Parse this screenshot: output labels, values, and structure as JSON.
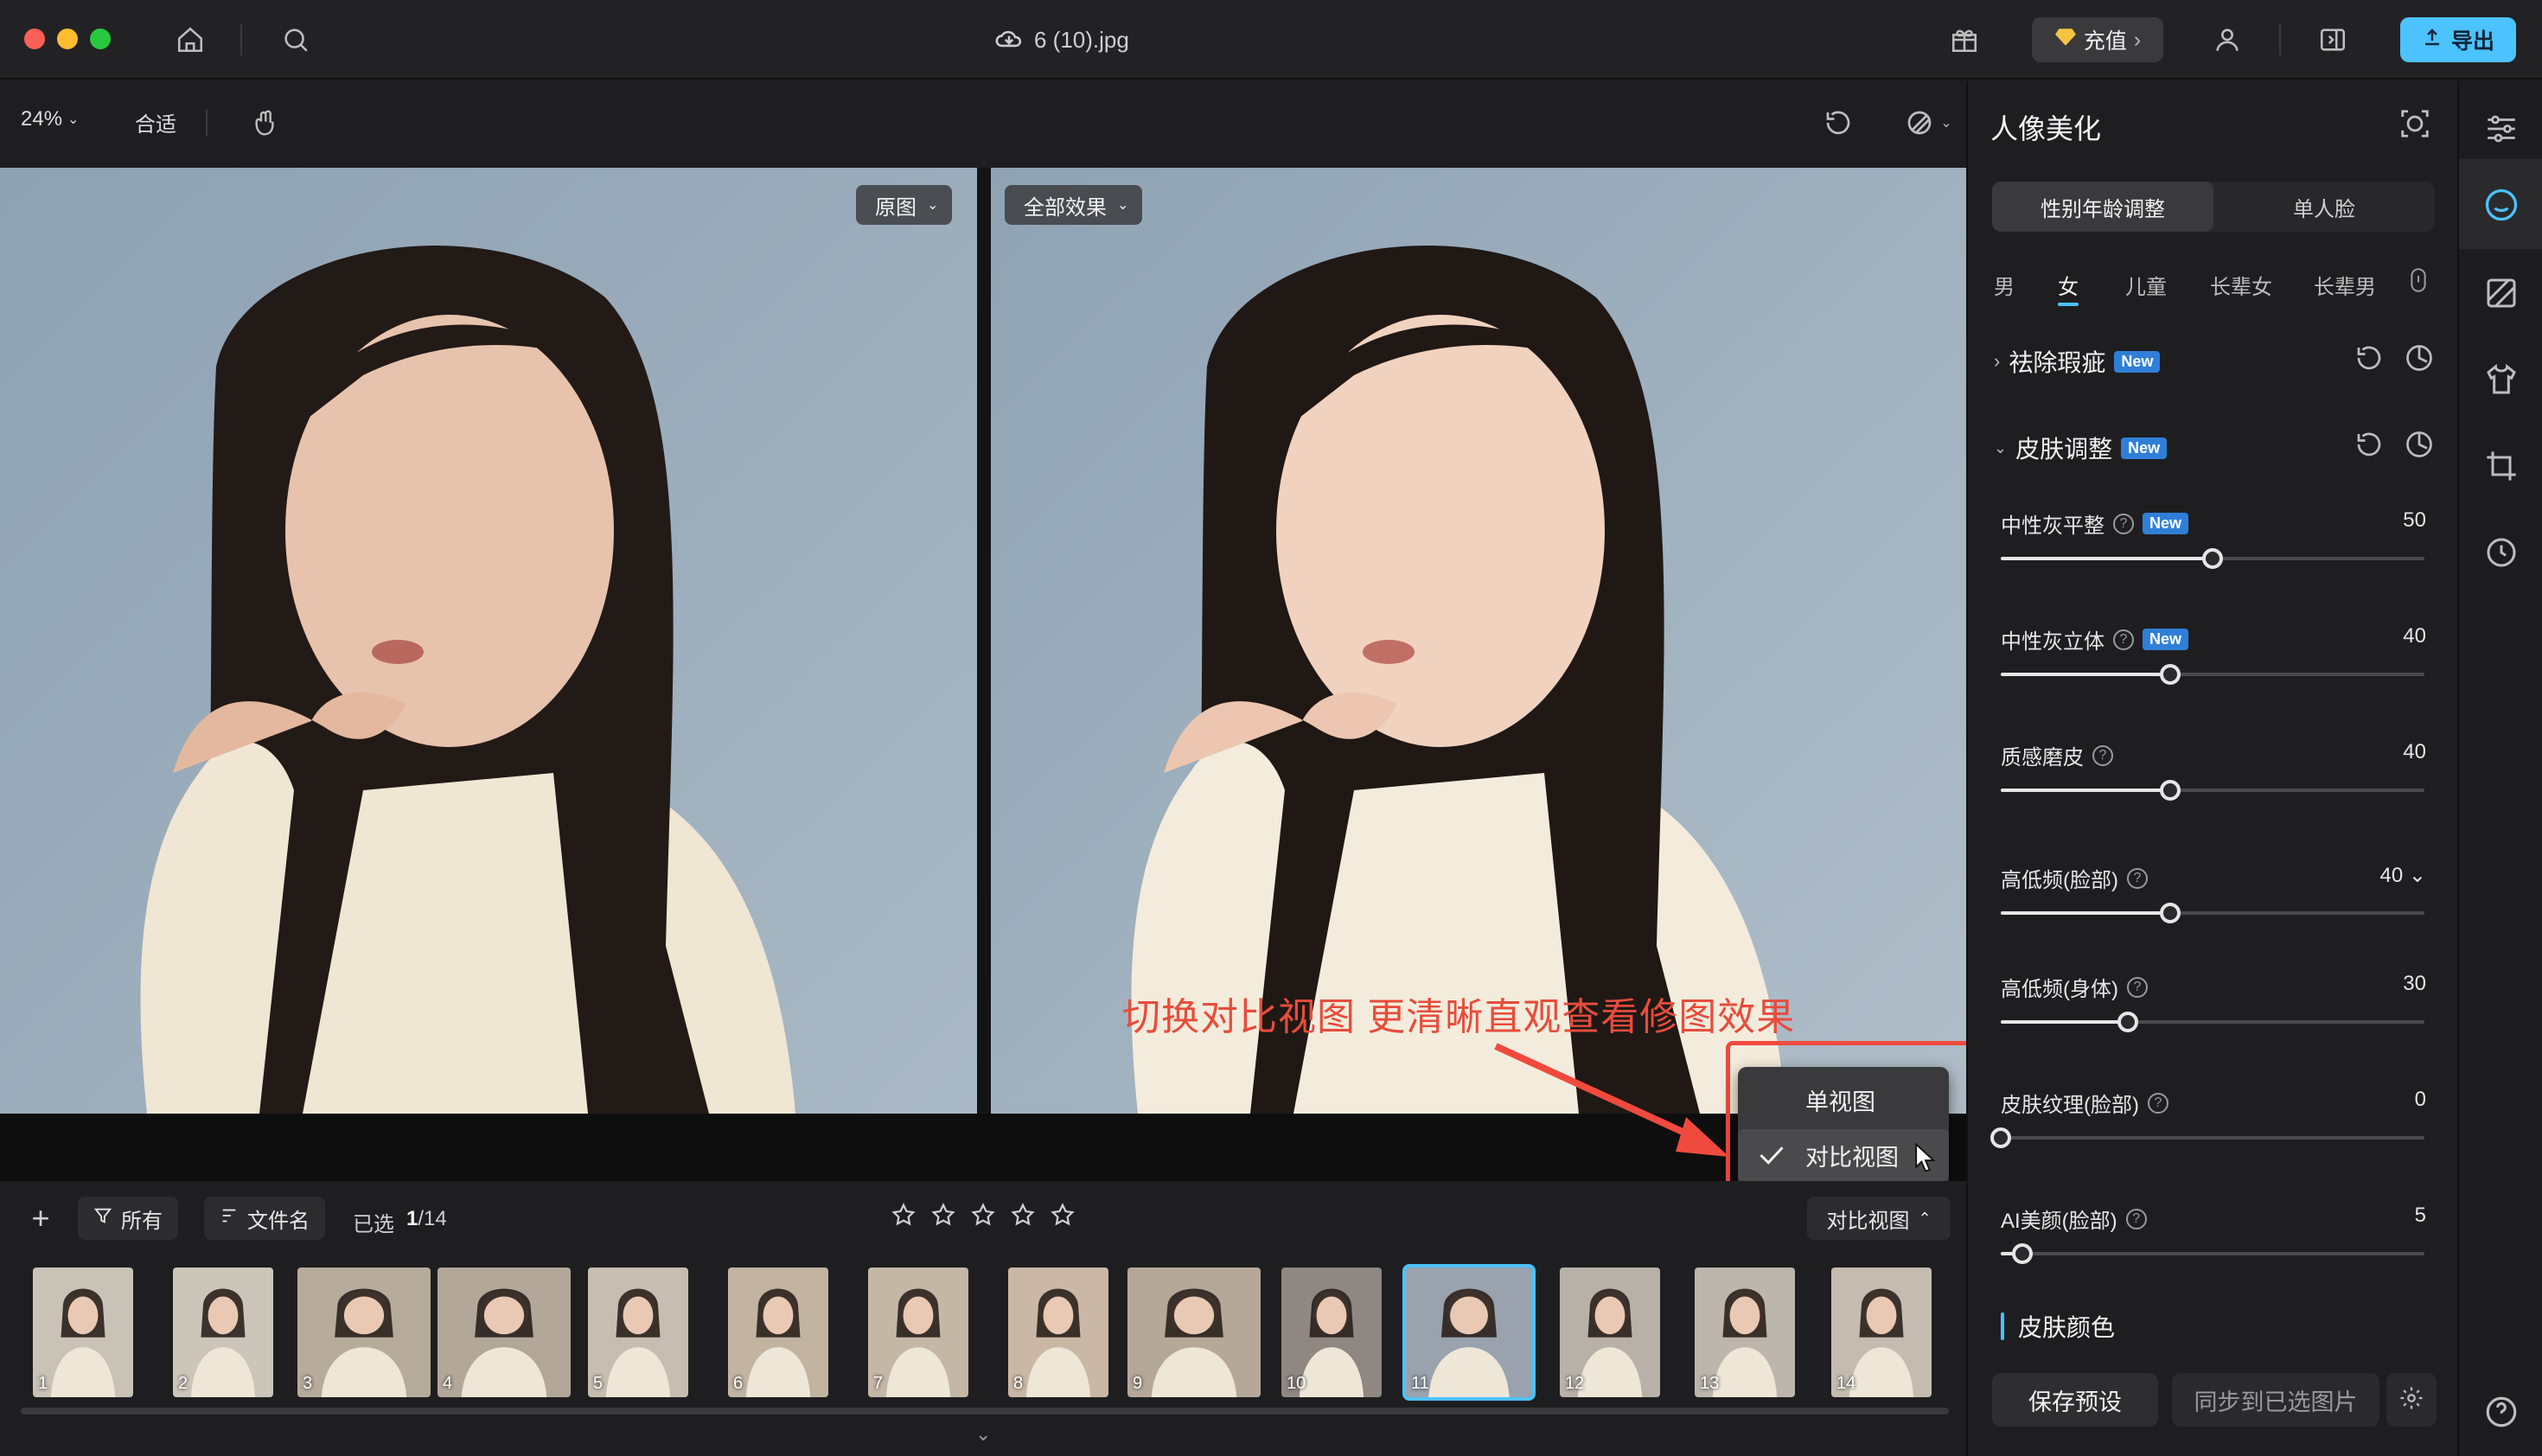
{
  "window": {
    "file_name": "6 (10).jpg",
    "recharge_label": "充值",
    "export_label": "导出"
  },
  "toolbar": {
    "zoom_value": "24%",
    "fit_label": "合适"
  },
  "canvas": {
    "left_view_label": "原图",
    "right_view_label": "全部效果",
    "annotation_text": "切换对比视图 更清晰直观查看修图效果"
  },
  "view_menu": {
    "options": [
      "单视图",
      "对比视图"
    ],
    "selected": "对比视图"
  },
  "filmbar": {
    "filter_label": "所有",
    "sort_label": "文件名",
    "selected_label": "已选",
    "selected_count": "1",
    "total_count": "/14",
    "compare_button_label": "对比视图",
    "rating_stars": 5,
    "thumbnails": [
      "1",
      "2",
      "3",
      "4",
      "5",
      "6",
      "7",
      "8",
      "9",
      "10",
      "11",
      "12",
      "13",
      "14"
    ],
    "active_thumbnail": "11"
  },
  "panel": {
    "title": "人像美化",
    "segments": [
      "性别年龄调整",
      "单人脸"
    ],
    "tabs": [
      "男",
      "女",
      "儿童",
      "长辈女",
      "长辈男"
    ],
    "active_tab": "女",
    "sections": {
      "blemish": {
        "label": "祛除瑕疵",
        "badge": "New"
      },
      "skin": {
        "label": "皮肤调整",
        "badge": "New"
      }
    },
    "sliders": [
      {
        "label": "中性灰平整",
        "help": "?",
        "badge": "New",
        "value": "50",
        "level": 50,
        "min": 0,
        "max": 100
      },
      {
        "label": "中性灰立体",
        "help": "?",
        "badge": "New",
        "value": "40",
        "level": 40,
        "min": 0,
        "max": 100
      },
      {
        "label": "质感磨皮",
        "help": "?",
        "value": "40",
        "level": 40,
        "min": 0,
        "max": 100
      },
      {
        "label": "高低频(脸部)",
        "help": "?",
        "value": "40",
        "level": 40,
        "min": 0,
        "max": 100,
        "dropdown": true
      },
      {
        "label": "高低频(身体)",
        "help": "?",
        "value": "30",
        "level": 30,
        "min": 0,
        "max": 100
      },
      {
        "label": "皮肤纹理(脸部)",
        "help": "?",
        "value": "0",
        "level": 0,
        "min": 0,
        "max": 100
      },
      {
        "label": "AI美颜(脸部)",
        "help": "?",
        "value": "5",
        "level": 5,
        "min": 0,
        "max": 100
      }
    ],
    "color_section": "皮肤颜色",
    "save_preset_label": "保存预设",
    "sync_label": "同步到已选图片"
  },
  "colors": {
    "accent": "#4cc2ff",
    "annotation": "#e74c3c",
    "new_badge": "#2f7fd8"
  }
}
